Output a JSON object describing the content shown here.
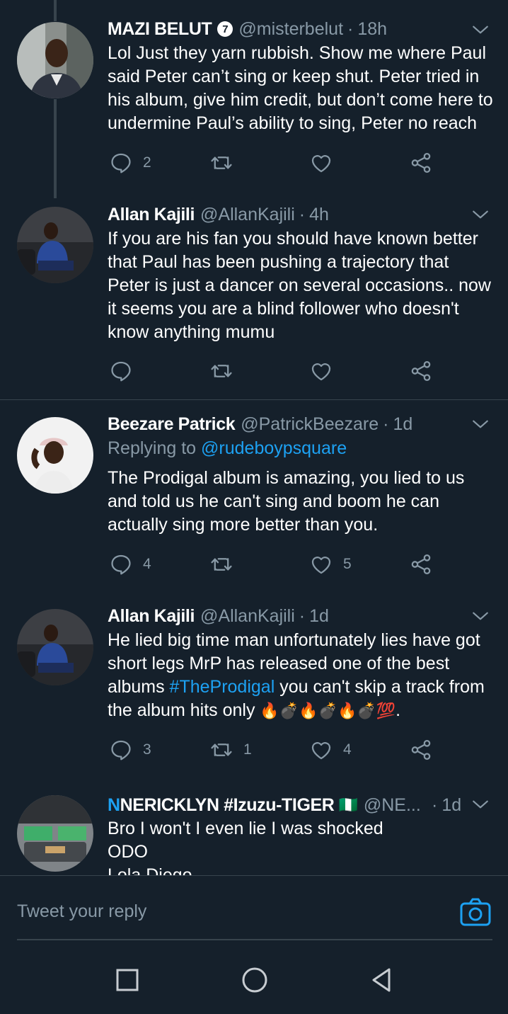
{
  "tweets": [
    {
      "name": "MAZI BELUT",
      "badge": "7",
      "handle": "@misterbelut",
      "time": "18h",
      "text": "Lol Just they yarn rubbish. Show me where Paul said Peter can’t sing or keep shut. Peter tried in his album, give him credit, but don’t come here to undermine Paul’s ability to sing,  Peter no reach",
      "replies": "2",
      "retweets": "",
      "likes": ""
    },
    {
      "name": "Allan Kajili",
      "handle": "@AllanKajili",
      "time": "4h",
      "text": "If you are his fan you should have known better that Paul has been pushing a trajectory that Peter is just a dancer on several occasions.. now it seems you are a blind follower who doesn't know anything mumu",
      "replies": "",
      "retweets": "",
      "likes": ""
    },
    {
      "name": "Beezare Patrick",
      "handle": "@PatrickBeezare",
      "time": "1d",
      "replying_label": "Replying to",
      "replying_to": "@rudeboypsquare",
      "text": "The Prodigal album is amazing, you lied to us and told us he can't sing and boom he can actually sing more better than you.",
      "replies": "4",
      "retweets": "",
      "likes": "5"
    },
    {
      "name": "Allan Kajili",
      "handle": "@AllanKajili",
      "time": "1d",
      "text_a": "He lied big time man unfortunately lies have got short legs MrP has released one of the best albums ",
      "hashtag": "#TheProdigal",
      "text_b": " you can't skip a track from the album hits only ",
      "emojis": "🔥💣🔥💣🔥💣💯",
      "text_c": ".",
      "replies": "3",
      "retweets": "1",
      "likes": "4"
    },
    {
      "name": "NERICKLYN #Izuzu-TIGER",
      "name_prefix": "N",
      "flag": "🇳🇬",
      "handle": "@NE...",
      "time": "1d",
      "lines": [
        "Bro I won't I even lie I was shocked",
        "ODO",
        "Lola Diego"
      ]
    }
  ],
  "reply_bar": {
    "placeholder": "Tweet your reply"
  },
  "colors": {
    "background": "#15202b",
    "muted": "#8899a6",
    "link": "#1da1f2",
    "divider": "#38444d"
  },
  "icons": [
    "reply-icon",
    "retweet-icon",
    "like-icon",
    "share-icon",
    "chevron-down-icon",
    "camera-icon"
  ]
}
